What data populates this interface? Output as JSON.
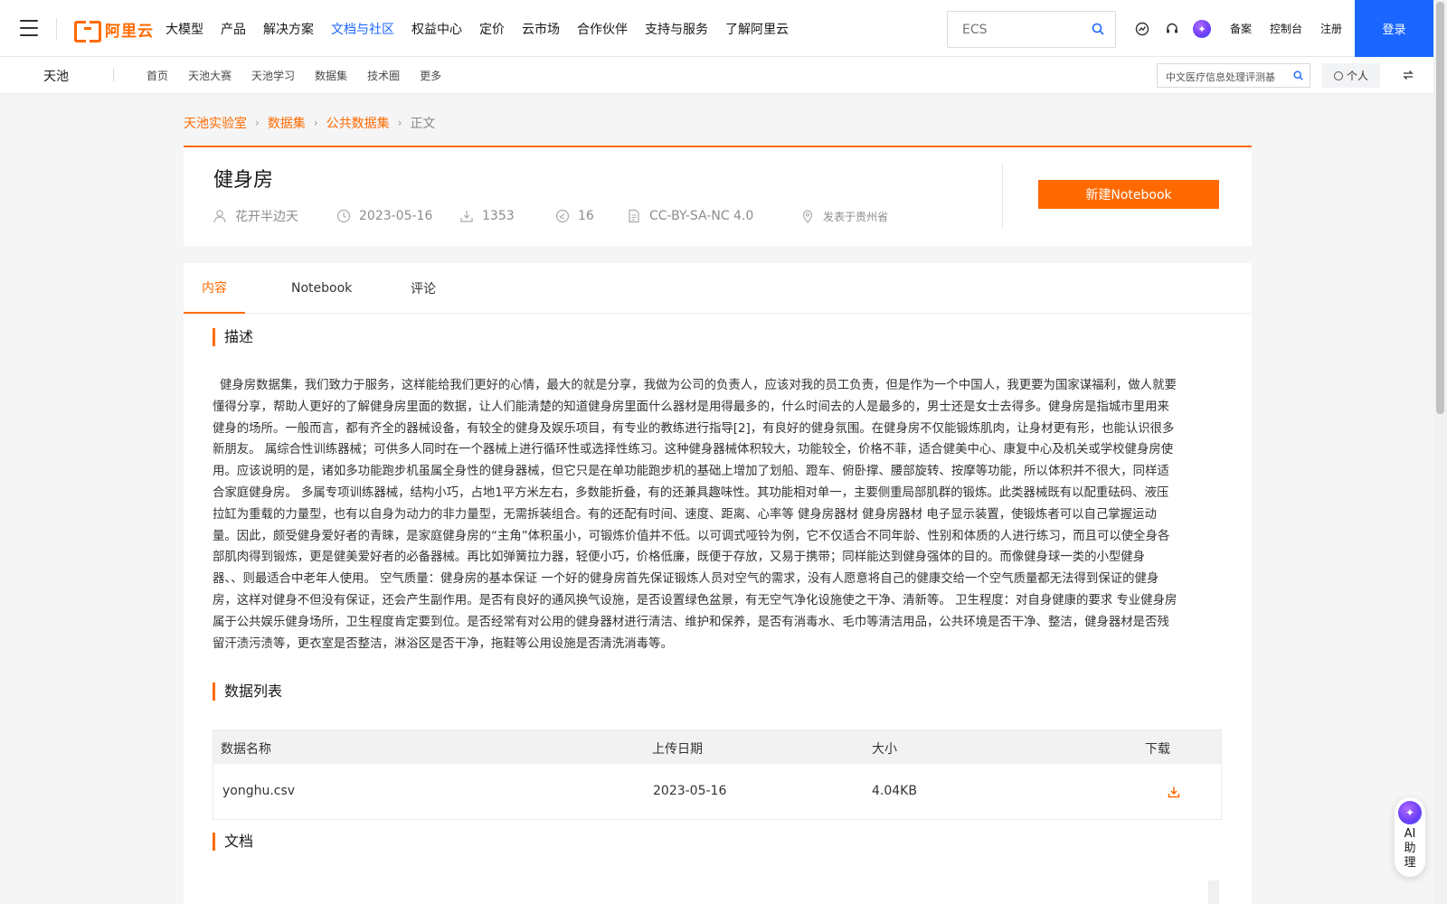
{
  "topbar": {
    "logo_text": "阿里云",
    "nav": [
      "大模型",
      "产品",
      "解决方案",
      "文档与社区",
      "权益中心",
      "定价",
      "云市场",
      "合作伙伴",
      "支持与服务",
      "了解阿里云"
    ],
    "active_nav": "文档与社区",
    "search_placeholder": "ECS",
    "links": [
      "备案",
      "控制台",
      "注册"
    ],
    "login_label": "登录",
    "accent_color": "#1a66ff"
  },
  "subnav": {
    "brand": "天池",
    "items": [
      "首页",
      "天池大赛",
      "天池学习",
      "数据集",
      "技术圈",
      "更多"
    ],
    "search_text": "中文医疗信息处理评测基",
    "personal_label": "个人"
  },
  "breadcrumb": [
    "天池实验室",
    "数据集",
    "公共数据集",
    "正文"
  ],
  "dataset": {
    "title": "健身房",
    "author": "花开半边天",
    "date": "2023-05-16",
    "downloads": "1353",
    "shares": "16",
    "license": "CC-BY-SA-NC 4.0",
    "location": "发表于贵州省",
    "notebook_button": "新建Notebook",
    "brand_color": "#ff6a00"
  },
  "tabs": [
    "内容",
    "Notebook",
    "评论"
  ],
  "sections": {
    "description_title": "描述",
    "description_lines": [
      "健身房数据集，我们致力于服务，这样能给我们更好的心情，最大的就是分享，我做为公司的负责人，应该对我的员工负责，但是作为一个中国人，我更要为国家谋福利，做人就要",
      "懂得分享，帮助人更好的了解健身房里面的数据，让人们能清楚的知道健身房里面什么器材是用得最多的，什么时间去的人是最多的，男士还是女士去得多。健身房是指城市里用来",
      "健身的场所。一般而言，都有齐全的器械设备，有较全的健身及娱乐项目，有专业的教练进行指导[2]，有良好的健身氛围。在健身房不仅能锻炼肌肉，让身材更有形，也能认识很多",
      "新朋友。 属综合性训练器械；可供多人同时在一个器械上进行循环性或选择性练习。这种健身器械体积较大，功能较全，价格不菲，适合健美中心、康复中心及机关或学校健身房使",
      "用。应该说明的是，诸如多功能跑步机虽属全身性的健身器械，但它只是在单功能跑步机的基础上增加了划船、蹬车、俯卧撑、腰部旋转、按摩等功能，所以体积并不很大，同样适",
      "合家庭健身房。 多属专项训练器械，结构小巧，占地1平方米左右，多数能折叠，有的还兼具趣味性。其功能相对单一，主要侧重局部肌群的锻炼。此类器械既有以配重砝码、液压",
      "拉缸为重载的力量型，也有以自身为动力的非力量型，无需拆装组合。有的还配有时间、速度、距离、心率等 健身房器材 健身房器材 电子显示装置，使锻炼者可以自己掌握运动",
      "量。因此，颇受健身爱好者的青睐，是家庭健身房的“主角”体积虽小，可锻炼价值并不低。以可调式哑铃为例，它不仅适合不同年龄、性别和体质的人进行练习，而且可以使全身各",
      "部肌肉得到锻炼，更是健美爱好者的必备器械。再比如弹簧拉力器，轻便小巧，价格低廉，既便于存放，又易于携带；同样能达到健身强体的目的。而像健身球一类的小型健身",
      "器、、则最适合中老年人使用。 空气质量：健身房的基本保证 一个好的健身房首先保证锻炼人员对空气的需求，没有人愿意将自己的健康交给一个空气质量都无法得到保证的健身",
      "房，这样对健身不但没有保证，还会产生副作用。是否有良好的通风换气设施，是否设置绿色盆景，有无空气净化设施使之干净、清新等。 卫生程度：对自身健康的要求 专业健身房",
      "属于公共娱乐健身场所，卫生程度肯定要到位。是否经常有对公用的健身器材进行清洁、维护和保养，是否有消毒水、毛巾等清洁用品，公共环境是否干净、整洁，健身器材是否残",
      "留汗渍污渍等，更衣室是否整洁，淋浴区是否干净，拖鞋等公用设施是否清洗消毒等。"
    ],
    "data_list_title": "数据列表",
    "table_headers": [
      "数据名称",
      "上传日期",
      "大小",
      "下载"
    ],
    "table_rows": [
      {
        "name": "yonghu.csv",
        "date": "2023-05-16",
        "size": "4.04KB"
      }
    ],
    "doc_title": "文档"
  },
  "ai_helper": {
    "label": "AI助理"
  }
}
